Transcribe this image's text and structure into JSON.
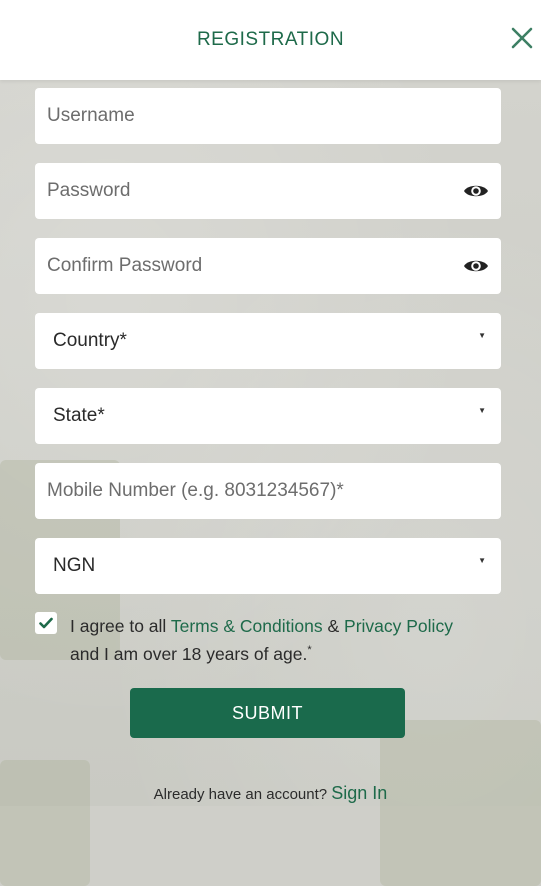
{
  "header": {
    "title": "REGISTRATION",
    "close_icon": "close-icon"
  },
  "form": {
    "username_placeholder": "Username",
    "password_placeholder": "Password",
    "confirm_password_placeholder": "Confirm Password",
    "country_value": "Country*",
    "state_value": "State*",
    "mobile_placeholder": "Mobile Number (e.g. 8031234567)*",
    "currency_value": "NGN"
  },
  "agreement": {
    "checked": true,
    "text_prefix": "I agree to all",
    "terms_link": "Terms & Conditions",
    "amp": "&",
    "privacy_link": "Privacy Policy",
    "text_suffix": "and I am over 18 years of age.",
    "asterisk": "*"
  },
  "submit_label": "SUBMIT",
  "footer": {
    "prompt": "Already have an account?",
    "signin_link": "Sign In"
  },
  "colors": {
    "accent": "#1e6a4a",
    "button": "#1a6a4c"
  }
}
